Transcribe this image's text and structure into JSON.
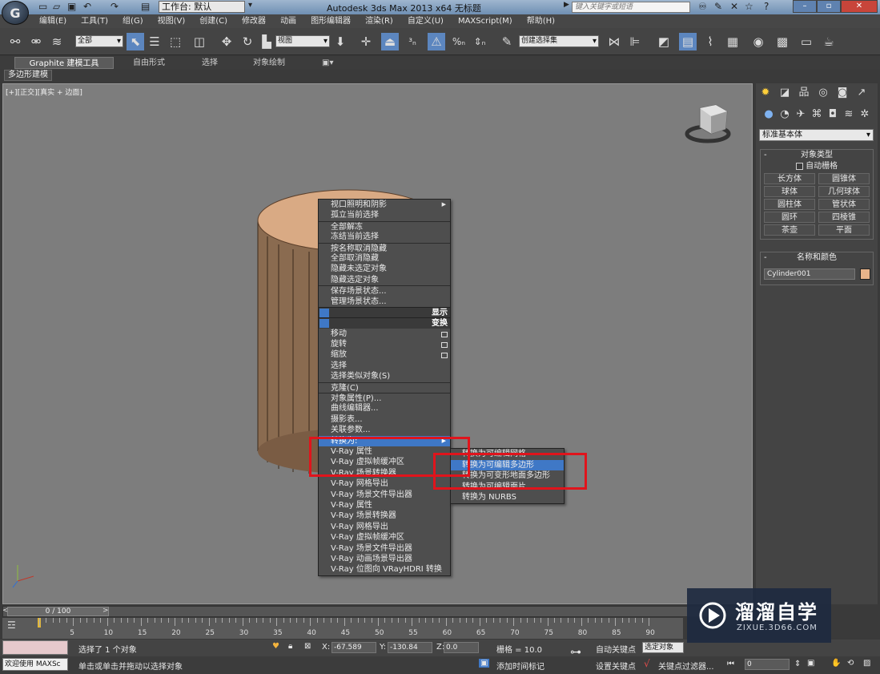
{
  "titlebar": {
    "app_icon": "G",
    "workspace": "工作台: 默认",
    "title": "Autodesk 3ds Max  2013 x64    无标题",
    "search_placeholder": "键入关键字或短语"
  },
  "menubar": [
    "编辑(E)",
    "工具(T)",
    "组(G)",
    "视图(V)",
    "创建(C)",
    "修改器",
    "动画",
    "图形编辑器",
    "渲染(R)",
    "自定义(U)",
    "MAXScript(M)",
    "帮助(H)"
  ],
  "toolbar": {
    "filter_select": "全部",
    "coord_select": "视图",
    "named_set_select": "创建选择集"
  },
  "ribbon": {
    "tabs": [
      "Graphite 建模工具",
      "自由形式",
      "选择",
      "对象绘制"
    ],
    "subtab": "多边形建模"
  },
  "viewport": {
    "label": "[+][正交][真实 + 边面]",
    "object_color": "#d9aa84"
  },
  "context_menu": {
    "items": [
      "视口照明和阴影",
      "孤立当前选择",
      "全部解冻",
      "冻结当前选择",
      "按名称取消隐藏",
      "全部取消隐藏",
      "隐藏未选定对象",
      "隐藏选定对象",
      "保存场景状态...",
      "管理场景状态..."
    ],
    "header_display": "显示",
    "header_transform": "变换",
    "transform_items": [
      "移动",
      "旋转",
      "缩放",
      "选择",
      "选择类似对象(S)",
      "克隆(C)",
      "对象属性(P)...",
      "曲线编辑器...",
      "摄影表...",
      "关联参数..."
    ],
    "convert_to": "转换为:",
    "vray_items": [
      "V-Ray 属性",
      "V-Ray 虚拟帧缓冲区",
      "V-Ray 场景转换器",
      "V-Ray 网格导出",
      "V-Ray 场景文件导出器",
      "V-Ray 属性",
      "V-Ray 场景转换器",
      "V-Ray 网格导出",
      "V-Ray 虚拟帧缓冲区",
      "V-Ray 场景文件导出器",
      "V-Ray 动画场景导出器",
      "V-Ray 位图向 VRayHDRI 转换"
    ]
  },
  "submenu": {
    "items": [
      "转换为可编辑网格",
      "转换为可编辑多边形",
      "转换为可变形地面多边形",
      "转换为可编辑面片",
      "转换为 NURBS"
    ]
  },
  "command_panel": {
    "category_select": "标准基本体",
    "object_type_title": "对象类型",
    "autogrid": "自动栅格",
    "primitives": [
      "长方体",
      "圆锥体",
      "球体",
      "几何球体",
      "圆柱体",
      "管状体",
      "圆环",
      "四棱锥",
      "茶壶",
      "平面"
    ],
    "name_color_title": "名称和颜色",
    "object_name": "Cylinder001",
    "object_color": "#e8b48a"
  },
  "timeline": {
    "frame_display": "0 / 100",
    "ticks": [
      "5",
      "10",
      "15",
      "20",
      "25",
      "30",
      "35",
      "40",
      "45",
      "50",
      "55",
      "60",
      "65",
      "70",
      "75",
      "80",
      "85",
      "90"
    ]
  },
  "status": {
    "selection_info": "选择了 1 个对象",
    "prompt": "单击或单击并拖动以选择对象",
    "script_label": "欢迎使用 MAXSc",
    "x_label": "X:",
    "x_value": "-67.589",
    "y_label": "Y:",
    "y_value": "-130.84",
    "z_label": "Z:",
    "z_value": "0.0",
    "grid": "栅格 = 10.0",
    "add_time_tag": "添加时间标记",
    "auto_key": "自动关键点",
    "set_key": "设置关键点",
    "selected_select": "选定对象",
    "key_filters": "关键点过滤器...",
    "frame_field": "0"
  },
  "watermark": {
    "title": "溜溜自学",
    "subtitle": "ZIXUE.3D66.COM"
  }
}
